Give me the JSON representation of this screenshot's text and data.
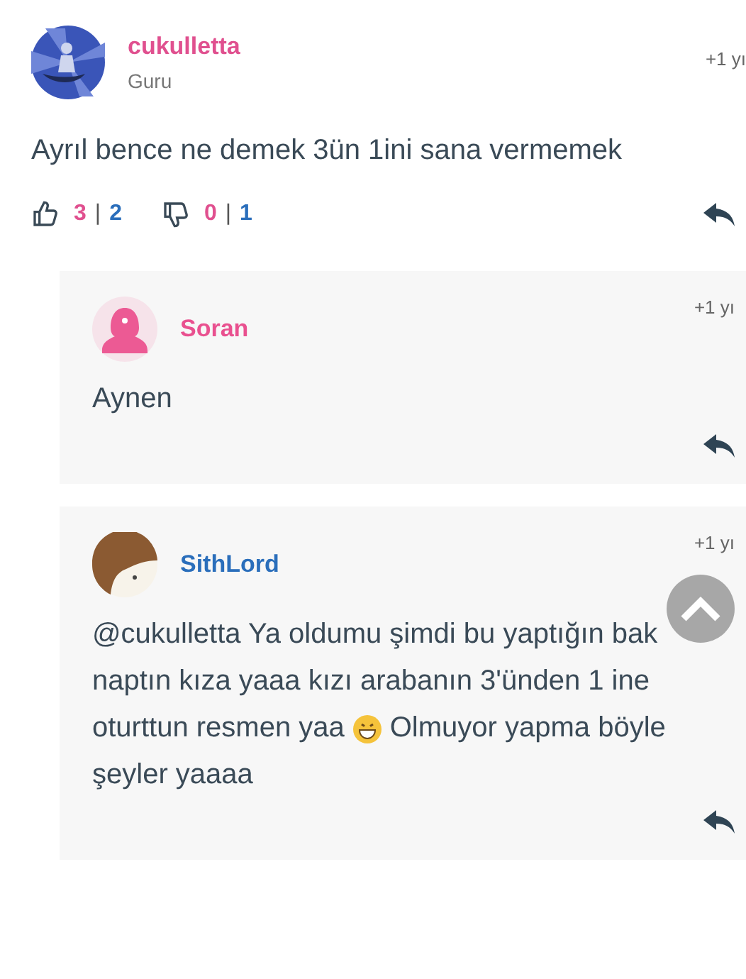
{
  "comment": {
    "author": "cukulletta",
    "color": "#e0508f",
    "rank": "Guru",
    "time": "+1 yı",
    "text": "Ayrıl bence ne demek 3ün 1ini sana vermemek",
    "likes": "3",
    "likes_other": "2",
    "dislikes": "0",
    "dislikes_other": "1",
    "separator": "|"
  },
  "replies": [
    {
      "author": "Soran",
      "color": "#e9508f",
      "avatar": {
        "kind": "anonymous"
      },
      "time": "+1 yı",
      "lines": [
        [
          {
            "kind": "text",
            "text": "Aynen"
          }
        ]
      ]
    },
    {
      "author": "SithLord",
      "color": "#2a6ebb",
      "avatar": {
        "kind": "user"
      },
      "time": "+1 yı",
      "lines": [
        [
          {
            "kind": "text",
            "text": "@cukulletta Ya oldumu şimdi bu yaptığın bak"
          }
        ],
        [
          {
            "kind": "text",
            "text": "naptın kıza yaaa kızı arabanın 3'ünden 1 ine"
          }
        ],
        [
          {
            "kind": "text",
            "text": "oturttun resmen yaa"
          },
          {
            "kind": "emoji"
          },
          {
            "kind": "text",
            "text": "Olmuyor yapma böyle"
          }
        ],
        [
          {
            "kind": "text",
            "text": "şeyler yaaaa"
          }
        ]
      ]
    }
  ]
}
